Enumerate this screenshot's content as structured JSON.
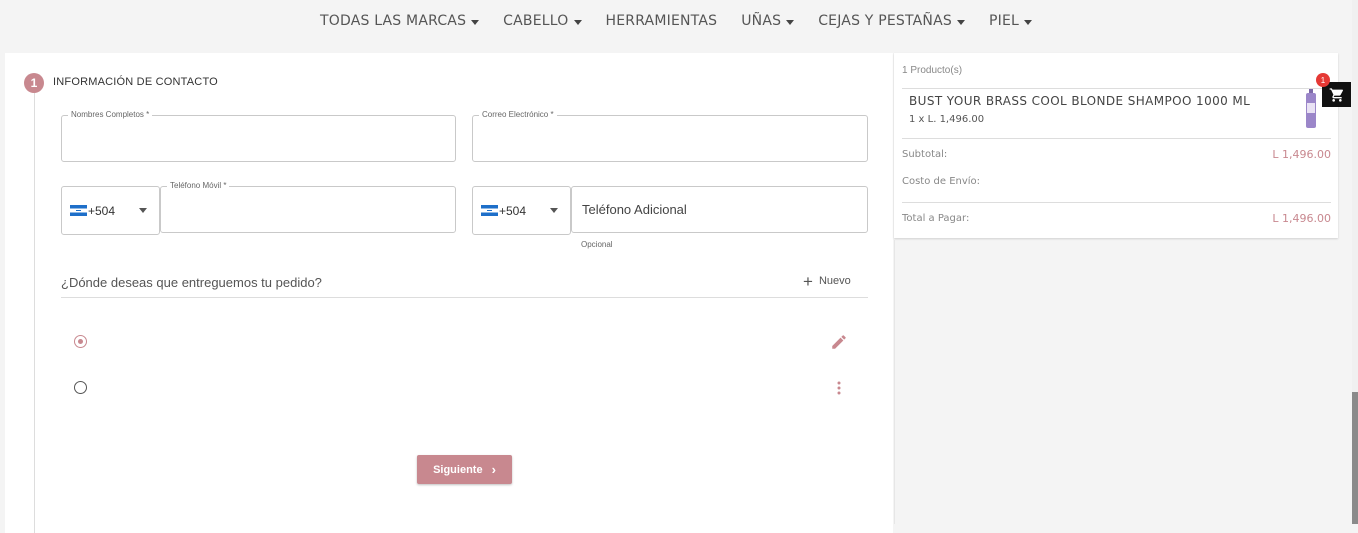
{
  "nav": {
    "items": [
      {
        "label": "TODAS LAS MARCAS",
        "has_caret": true
      },
      {
        "label": "CABELLO",
        "has_caret": true
      },
      {
        "label": "HERRAMIENTAS",
        "has_caret": false
      },
      {
        "label": "UÑAS",
        "has_caret": true
      },
      {
        "label": "CEJAS Y PESTAÑAS",
        "has_caret": true
      },
      {
        "label": "PIEL",
        "has_caret": true
      }
    ]
  },
  "step": {
    "number": "1",
    "title": "INFORMACIÓN DE CONTACTO"
  },
  "form": {
    "full_name_label": "Nombres Completos *",
    "email_label": "Correo Electrónico *",
    "mobile_country_code": "+504",
    "mobile_label": "Teléfono Móvil *",
    "extra_country_code": "+504",
    "extra_phone_placeholder": "Teléfono Adicional",
    "extra_phone_hint": "Opcional"
  },
  "delivery": {
    "question": "¿Dónde deseas que entreguemos tu pedido?",
    "new_label": "Nuevo",
    "addresses": [
      {
        "selected": true,
        "action_icon": "edit-icon"
      },
      {
        "selected": false,
        "action_icon": "more-vert-icon"
      }
    ]
  },
  "next_button_label": "Siguiente",
  "summary": {
    "count_label": "1 Producto(s)",
    "product": {
      "name": "BUST YOUR BRASS COOL BLONDE SHAMPOO 1000 ML",
      "qty_price": "1 x L.  1,496.00"
    },
    "subtotal_label": "Subtotal:",
    "subtotal_value": "L  1,496.00",
    "shipping_label": "Costo de Envío:",
    "total_label": "Total a Pagar:",
    "total_value": "L  1,496.00"
  },
  "cart": {
    "badge": "1",
    "icon": "shopping-cart-icon"
  },
  "colors": {
    "accent": "#c8888f",
    "badge": "#e53935",
    "cart_bg": "#111111"
  }
}
